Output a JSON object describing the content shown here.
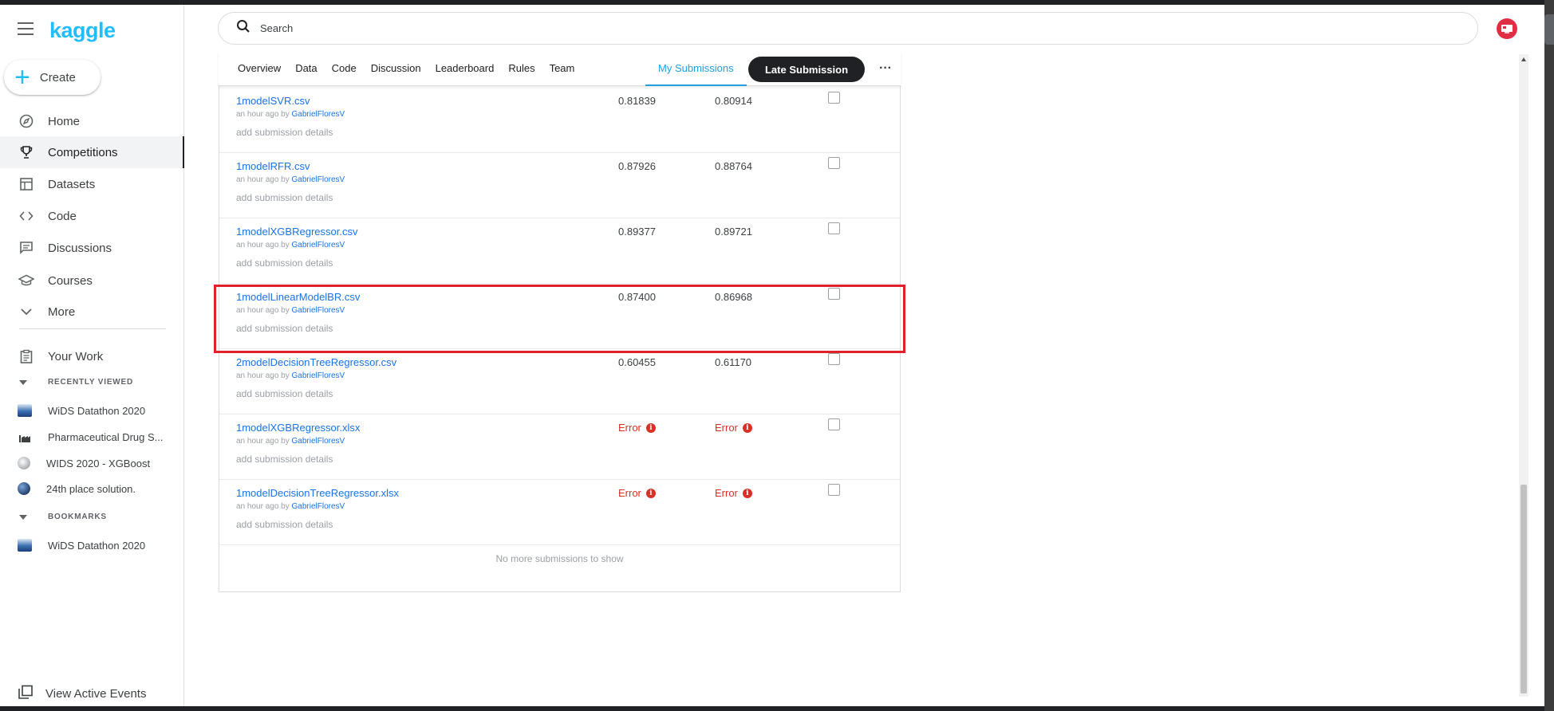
{
  "brand": {
    "logo": "kaggle"
  },
  "sidebar": {
    "create_label": "Create",
    "nav": [
      {
        "label": "Home",
        "icon": "compass-icon"
      },
      {
        "label": "Competitions",
        "icon": "trophy-icon",
        "active": true
      },
      {
        "label": "Datasets",
        "icon": "table-icon"
      },
      {
        "label": "Code",
        "icon": "code-icon"
      },
      {
        "label": "Discussions",
        "icon": "comment-icon"
      },
      {
        "label": "Courses",
        "icon": "graduation-cap-icon"
      },
      {
        "label": "More",
        "icon": "chevron-down-icon"
      }
    ],
    "your_work": "Your Work",
    "recently_viewed_heading": "RECENTLY VIEWED",
    "recently_viewed": [
      "WiDS Datathon 2020",
      "Pharmaceutical Drug S...",
      "WIDS 2020 - XGBoost",
      "24th place solution."
    ],
    "bookmarks_heading": "BOOKMARKS",
    "bookmarks": [
      "WiDS Datathon 2020"
    ],
    "view_active_events": "View Active Events"
  },
  "search": {
    "placeholder": "Search"
  },
  "tabs": [
    "Overview",
    "Data",
    "Code",
    "Discussion",
    "Leaderboard",
    "Rules",
    "Team"
  ],
  "my_submissions_tab": "My Submissions",
  "late_submission_label": "Late Submission",
  "more_label": "···",
  "submissions": [
    {
      "file": "1modelSVR.csv",
      "time": "an hour ago by",
      "user": "GabrielFloresV",
      "details": "add submission details",
      "public": "0.81839",
      "private": "0.80914"
    },
    {
      "file": "1modelRFR.csv",
      "time": "an hour ago by",
      "user": "GabrielFloresV",
      "details": "add submission details",
      "public": "0.87926",
      "private": "0.88764"
    },
    {
      "file": "1modelXGBRegressor.csv",
      "time": "an hour ago by",
      "user": "GabrielFloresV",
      "details": "add submission details",
      "public": "0.89377",
      "private": "0.89721"
    },
    {
      "file": "1modelLinearModelBR.csv",
      "time": "an hour ago by",
      "user": "GabrielFloresV",
      "details": "add submission details",
      "public": "0.87400",
      "private": "0.86968"
    },
    {
      "file": "2modelDecisionTreeRegressor.csv",
      "time": "an hour ago by",
      "user": "GabrielFloresV",
      "details": "add submission details",
      "public": "0.60455",
      "private": "0.61170"
    },
    {
      "file": "1modelXGBRegressor.xlsx",
      "time": "an hour ago by",
      "user": "GabrielFloresV",
      "details": "add submission details",
      "public": "Error",
      "private": "Error"
    },
    {
      "file": "1modelDecisionTreeRegressor.xlsx",
      "time": "an hour ago by",
      "user": "GabrielFloresV",
      "details": "add submission details",
      "public": "Error",
      "private": "Error"
    }
  ],
  "no_more_text": "No more submissions to show",
  "colors": {
    "accent": "#20beff",
    "link": "#1a73e8",
    "error": "#d93025",
    "highlight": "#e0202b"
  }
}
